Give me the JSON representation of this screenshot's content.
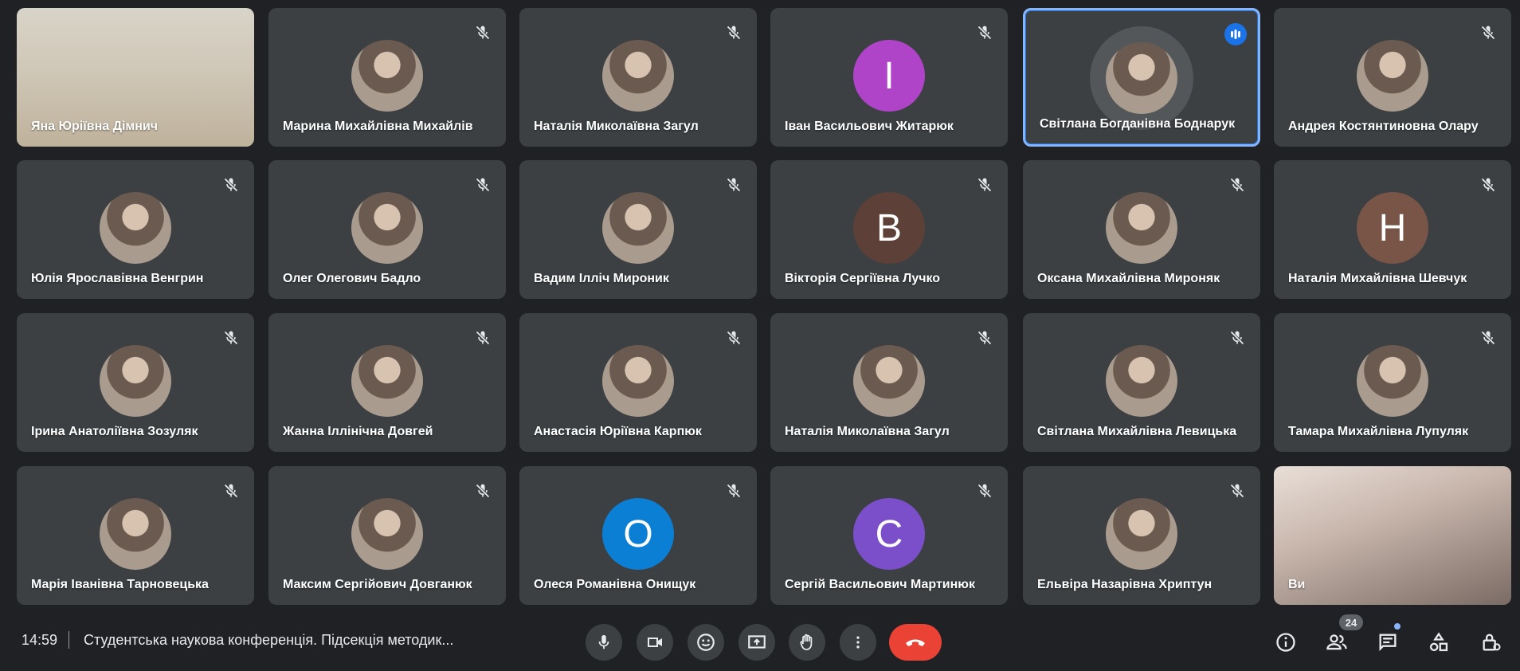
{
  "participants": [
    {
      "name": "Яна Юріївна Дімнич",
      "type": "video"
    },
    {
      "name": "Марина Михайлівна Михайлів",
      "type": "photo"
    },
    {
      "name": "Наталія Миколаївна Загул",
      "type": "photo"
    },
    {
      "name": "Іван Васильович Житарюк",
      "type": "letter",
      "letter": "І",
      "color": "#b044c9"
    },
    {
      "name": "Світлана Богданівна Боднарук",
      "type": "photo",
      "speaking": true
    },
    {
      "name": "Андрея Костянтиновна Олару",
      "type": "photo"
    },
    {
      "name": "Юлія Ярославівна Венгрин",
      "type": "photo"
    },
    {
      "name": "Олег Олегович Бадло",
      "type": "photo"
    },
    {
      "name": "Вадим Ілліч Мироник",
      "type": "photo"
    },
    {
      "name": "Вікторія Сергіївна Лучко",
      "type": "letter",
      "letter": "В",
      "color": "#5d4037"
    },
    {
      "name": "Оксана Михайлівна Мироняк",
      "type": "photo"
    },
    {
      "name": "Наталія Михайлівна Шевчук",
      "type": "letter",
      "letter": "Н",
      "color": "#795548"
    },
    {
      "name": "Ірина Анатоліївна Зозуляк",
      "type": "photo"
    },
    {
      "name": "Жанна Іллінічна Довгей",
      "type": "photo"
    },
    {
      "name": "Анастасія Юріївна Карпюк",
      "type": "photo"
    },
    {
      "name": "Наталія Миколаївна Загул",
      "type": "photo"
    },
    {
      "name": "Світлана Михайлівна Левицька",
      "type": "photo"
    },
    {
      "name": "Тамара Михайлівна Лупуляк",
      "type": "photo"
    },
    {
      "name": "Марія Іванівна Тарновецька",
      "type": "photo"
    },
    {
      "name": "Максим Сергійович Довганюк",
      "type": "photo"
    },
    {
      "name": "Олеся Романівна Онищук",
      "type": "letter",
      "letter": "О",
      "color": "#0b7fd4"
    },
    {
      "name": "Сергій Васильович Мартинюк",
      "type": "letter",
      "letter": "С",
      "color": "#7b4fc9"
    },
    {
      "name": "Ельвіра Назарівна Хриптун",
      "type": "photo"
    },
    {
      "name": "Ви",
      "type": "video"
    }
  ],
  "bar": {
    "time": "14:59",
    "meeting_title": "Студентська наукова конференція. Підсекція методик...",
    "participant_count": "24"
  },
  "colors": {
    "background": "#202124",
    "tile": "#3c4043",
    "end_call": "#ea4335",
    "accent": "#1a73e8"
  },
  "icons": {
    "mute": "mic-off-icon",
    "speaking": "audio-level-icon",
    "mic": "mic-icon",
    "camera": "camera-icon",
    "emoji": "emoji-icon",
    "present": "present-screen-icon",
    "hand": "raise-hand-icon",
    "more": "more-vert-icon",
    "end": "end-call-icon",
    "info": "info-icon",
    "people": "people-icon",
    "chat": "chat-icon",
    "activities": "activities-icon",
    "host": "host-controls-icon"
  }
}
